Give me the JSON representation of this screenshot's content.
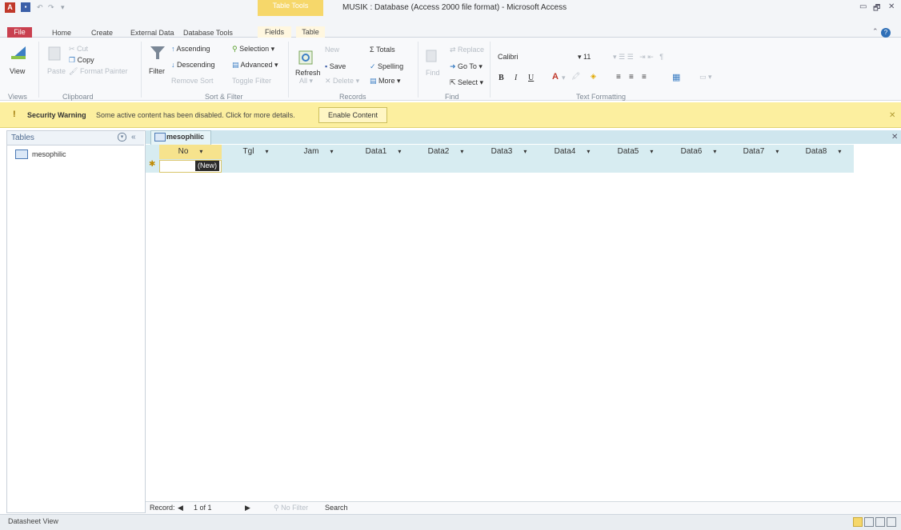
{
  "window": {
    "title": "MUSIK : Database (Access 2000 file format) - Microsoft Access",
    "app_icon": "A",
    "contextual_tab_header": "Table Tools",
    "controls": [
      "▭",
      "🗗",
      "✕"
    ]
  },
  "tabs": [
    "File",
    "Home",
    "Create",
    "External Data",
    "Database Tools",
    "Fields",
    "Table"
  ],
  "ribbon": {
    "views": {
      "view": "View",
      "group": "Views"
    },
    "clipboard": {
      "paste": "Paste",
      "cut": "Cut",
      "copy": "Copy",
      "format_painter": "Format Painter",
      "group": "Clipboard"
    },
    "sort_filter": {
      "filter": "Filter",
      "ascending": "Ascending",
      "descending": "Descending",
      "remove_sort": "Remove Sort",
      "selection": "Selection ▾",
      "advanced": "Advanced ▾",
      "toggle_filter": "Toggle Filter",
      "group": "Sort & Filter"
    },
    "records": {
      "refresh": "Refresh",
      "refresh_all": "All ▾",
      "new": "New",
      "save": "Save",
      "delete": "Delete ▾",
      "totals": "Totals",
      "spelling": "Spelling",
      "more": "More ▾",
      "group": "Records"
    },
    "find": {
      "find": "Find",
      "replace": "Replace",
      "goto": "Go To ▾",
      "select": "Select ▾",
      "group": "Find"
    },
    "text_formatting": {
      "font": "Calibri",
      "size": "11",
      "group": "Text Formatting",
      "bold": "B",
      "italic": "I",
      "underline": "U"
    }
  },
  "security_bar": {
    "title": "Security Warning",
    "message": "Some active content has been disabled. Click for more details.",
    "button": "Enable Content"
  },
  "nav_pane": {
    "title": "Tables",
    "items": [
      "mesophilic"
    ]
  },
  "document": {
    "tab": "mesophilic",
    "columns": [
      "No",
      "Tgl",
      "Jam",
      "Data1",
      "Data2",
      "Data3",
      "Data4",
      "Data5",
      "Data6",
      "Data7",
      "Data8"
    ],
    "new_row_label": "(New)"
  },
  "record_nav": {
    "label": "Record:",
    "first": "◀",
    "position": "1 of 1",
    "next": "▶",
    "filter": "No Filter",
    "search": "Search"
  },
  "status": {
    "text": "Datasheet View"
  },
  "colors": {
    "accent": "#c9404f",
    "warning_bar": "#fcef9f",
    "datasheet_header": "#d7ecf1",
    "selected_column": "#f6e38d"
  }
}
